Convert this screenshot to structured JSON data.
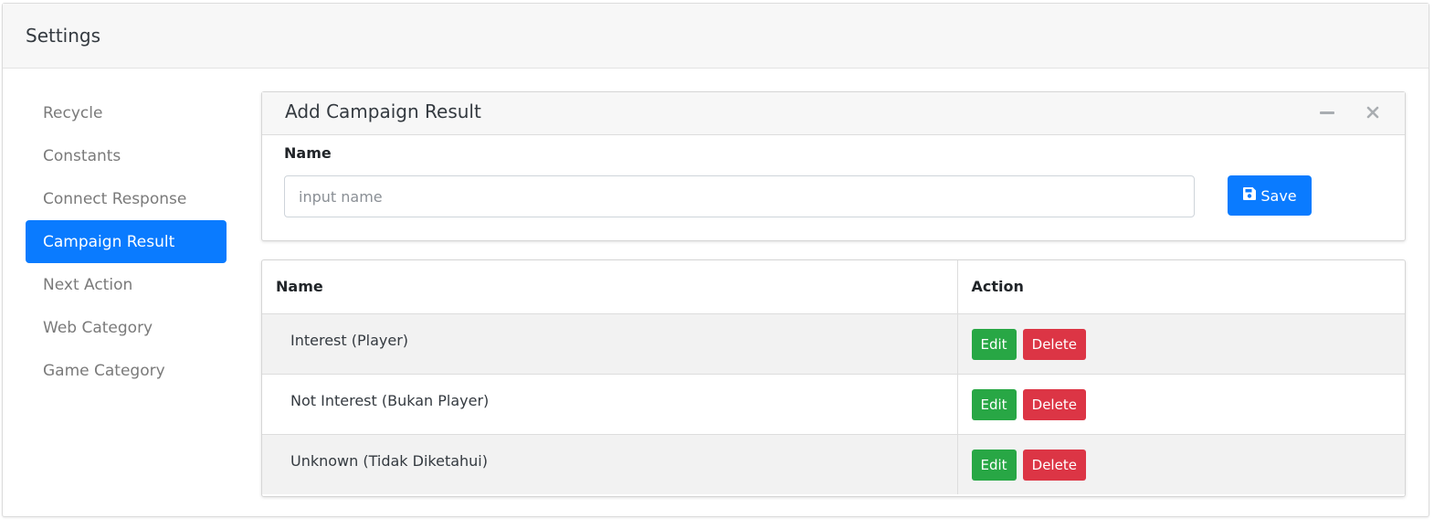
{
  "header": {
    "title": "Settings"
  },
  "sidebar": {
    "items": [
      {
        "label": "Recycle",
        "active": false
      },
      {
        "label": "Constants",
        "active": false
      },
      {
        "label": "Connect Response",
        "active": false
      },
      {
        "label": "Campaign Result",
        "active": true
      },
      {
        "label": "Next Action",
        "active": false
      },
      {
        "label": "Web Category",
        "active": false
      },
      {
        "label": "Game Category",
        "active": false
      }
    ]
  },
  "form": {
    "title": "Add Campaign Result",
    "name_label": "Name",
    "name_placeholder": "input name",
    "name_value": "",
    "save_label": "Save",
    "tools": [
      "minus-icon",
      "close-icon"
    ]
  },
  "table": {
    "columns": [
      "Name",
      "Action"
    ],
    "rows": [
      {
        "name": "Interest (Player)",
        "edit_label": "Edit",
        "delete_label": "Delete"
      },
      {
        "name": "Not Interest (Bukan Player)",
        "edit_label": "Edit",
        "delete_label": "Delete"
      },
      {
        "name": "Unknown (Tidak Diketahui)",
        "edit_label": "Edit",
        "delete_label": "Delete"
      }
    ]
  },
  "colors": {
    "primary": "#0a7bff",
    "success": "#28a745",
    "danger": "#dc3545",
    "header_bg": "#f7f7f7",
    "stripe_bg": "#f2f2f2"
  }
}
